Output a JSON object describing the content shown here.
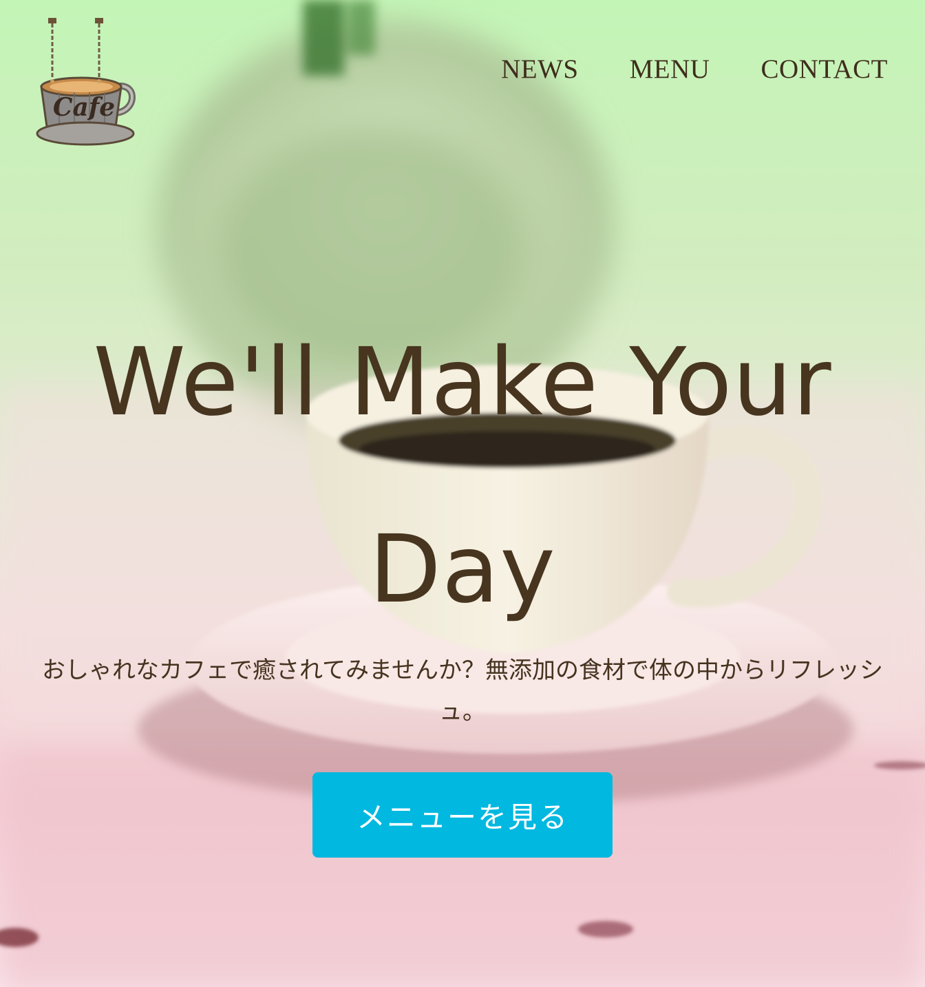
{
  "header": {
    "logo_name": "cafe-sign-logo",
    "logo_text": "Cafe",
    "nav": [
      {
        "label": "NEWS"
      },
      {
        "label": "MENU"
      },
      {
        "label": "CONTACT"
      }
    ]
  },
  "hero": {
    "headline": "We'll Make Your Day",
    "subtitle": "おしゃれなカフェで癒されてみませんか？無添加の食材で体の中からリフレッシュ。",
    "cta_label": "メニューを見る"
  },
  "colors": {
    "text": "#45331f",
    "button": "#00b8e0",
    "button_text": "#ffffff",
    "tint_top": "#c3f5b6",
    "tint_bottom": "#f6cdd5"
  }
}
